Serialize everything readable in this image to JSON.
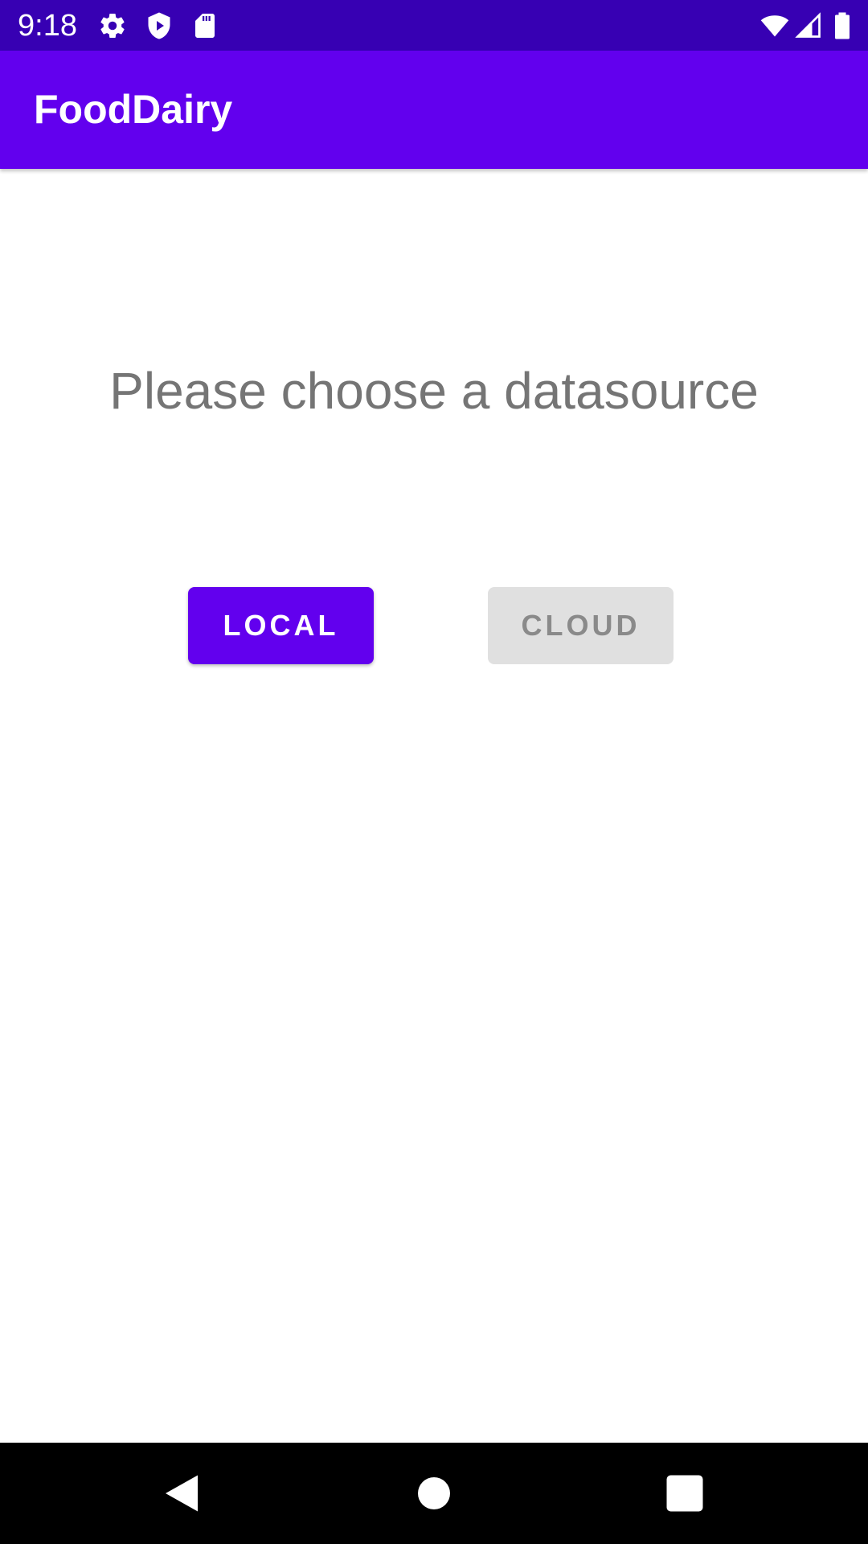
{
  "status_bar": {
    "time": "9:18",
    "icons_left": [
      "settings-gear-icon",
      "shield-play-icon",
      "sd-card-icon"
    ],
    "icons_right": [
      "wifi-icon",
      "cellular-signal-icon",
      "battery-icon"
    ]
  },
  "app_bar": {
    "title": "FoodDairy"
  },
  "main": {
    "prompt": "Please choose a datasource",
    "local_button_label": "LOCAL",
    "cloud_button_label": "CLOUD"
  },
  "nav_bar": {
    "icons": [
      "back-icon",
      "home-icon",
      "recents-icon"
    ]
  },
  "colors": {
    "status_bar": "#3700b3",
    "primary": "#6200ee",
    "disabled_button": "#e0e0e0",
    "prompt_text": "#757575"
  }
}
